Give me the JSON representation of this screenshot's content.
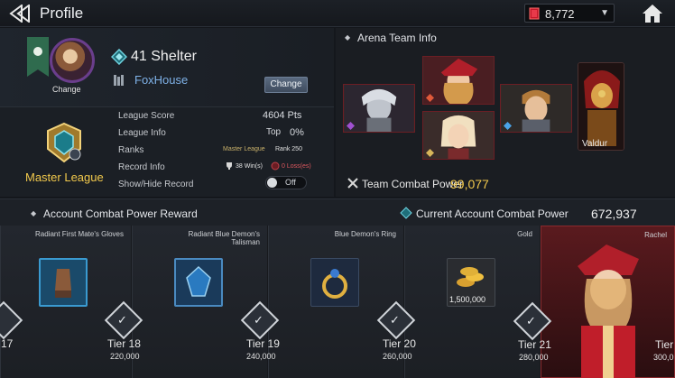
{
  "header": {
    "title": "Profile",
    "currency_amount": "8,772"
  },
  "profile": {
    "avatar_change_label": "Change",
    "player_name": "41 Shelter",
    "guild_name": "FoxHouse",
    "change_button_label": "Change",
    "league_name": "Master League",
    "league_badge": "IV",
    "stats": {
      "league_score_label": "League Score",
      "league_score_value": "4604 Pts",
      "league_info_label": "League Info",
      "league_info_top": "Top",
      "league_info_value": "0%",
      "ranks_label": "Ranks",
      "ranks_league": "Master League",
      "ranks_rank": "Rank 250",
      "record_info_label": "Record Info",
      "record_wins": "38 Win(s)",
      "record_losses": "0 Loss(es)",
      "show_hide_label": "Show/Hide Record",
      "toggle_state": "Off"
    }
  },
  "arena": {
    "title": "Arena Team Info",
    "leader_name": "Valdur",
    "team_power_label": "Team Combat Power",
    "team_power_value": "99,077"
  },
  "rewards": {
    "title": "Account Combat Power Reward",
    "current_power_label": "Current Account Combat Power",
    "current_power_value": "672,937",
    "cards": [
      {
        "name": "Radiant First Mate's Gloves",
        "tier": "17",
        "value": ""
      },
      {
        "name": "Radiant Blue Demon's Talisman",
        "tier": "Tier 18",
        "value": "220,000"
      },
      {
        "name": "Blue Demon's Ring",
        "tier": "Tier 19",
        "value": "240,000"
      },
      {
        "name": "Gold",
        "tier": "Tier 20",
        "value": "260,000",
        "qty": "1,500,000"
      },
      {
        "name": "Rachel",
        "tier": "Tier 21",
        "value": "280,000"
      },
      {
        "name": "",
        "tier": "Tier",
        "value": "300,0"
      }
    ]
  },
  "colors": {
    "accent_gold": "#f2c94c",
    "guild_blue": "#7fb2e8",
    "arena_red": "#6b1e24"
  }
}
